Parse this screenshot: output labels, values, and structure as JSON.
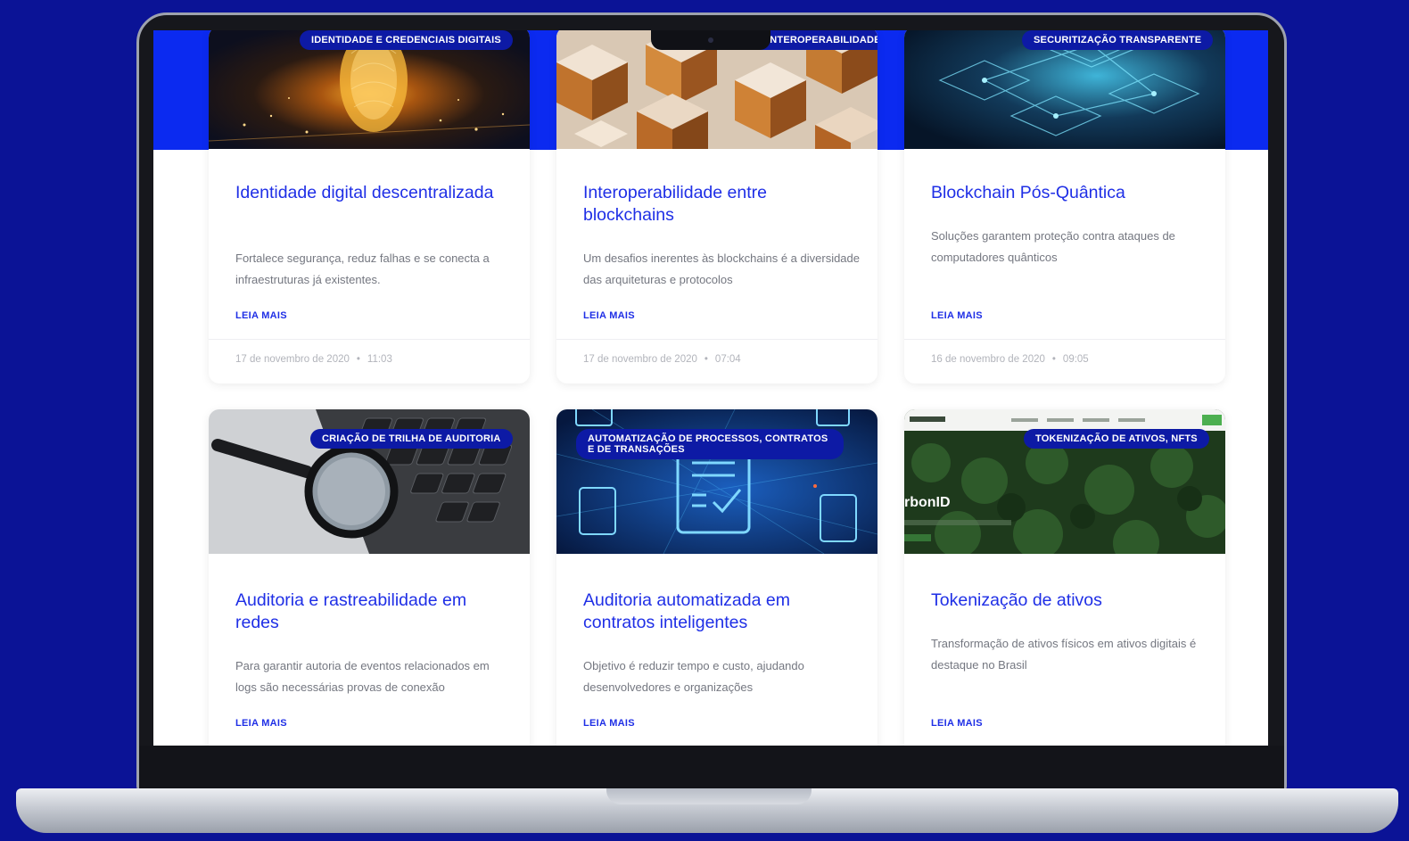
{
  "colors": {
    "background": "#0b1396",
    "accent": "#1f2fe6",
    "band": "#0b2af0",
    "tag": "#0d1aa5"
  },
  "read_more": "LEIA MAIS",
  "cards": [
    {
      "tag": "IDENTIDADE E CREDENCIAIS DIGITAIS",
      "title": "Identidade digital descentralizada",
      "description": "Fortalece segurança, reduz falhas e se conecta a infraestruturas já existentes.",
      "date": "17 de novembro de 2020",
      "time": "11:03",
      "image": "golden-fingerprint-city-image"
    },
    {
      "tag": "INTEROPERABILIDADE",
      "title": "Interoperabilidade entre blockchains",
      "description": "Um desafios inerentes às blockchains é a diversidade das arquiteturas e protocolos",
      "date": "17 de novembro de 2020",
      "time": "07:04",
      "image": "wooden-cubes-image"
    },
    {
      "tag": "SECURITIZAÇÃO TRANSPARENTE",
      "title": "Blockchain Pós-Quântica",
      "description": "Soluções garantem proteção contra ataques de computadores quânticos",
      "date": "16 de novembro de 2020",
      "time": "09:05",
      "image": "quantum-chip-network-image"
    },
    {
      "tag": "CRIAÇÃO DE TRILHA DE AUDITORIA",
      "title": "Auditoria e rastreabilidade em redes",
      "description": "Para garantir autoria de eventos relacionados em logs são necessárias provas de conexão",
      "image": "magnifier-keyboard-image"
    },
    {
      "tag": "AUTOMATIZAÇÃO DE PROCESSOS, CONTRATOS E DE TRANSAÇÕES",
      "title": "Auditoria automatizada em contratos inteligentes",
      "description": "Objetivo é reduzir tempo e custo, ajudando desenvolvedores e organizações",
      "image": "digital-documents-image"
    },
    {
      "tag": "TOKENIZAÇÃO DE ATIVOS, NFTS",
      "title": "Tokenização de ativos",
      "description": "Transformação de ativos físicos em ativos digitais é destaque no Brasil",
      "image": "forest-website-image",
      "image_text": "rbonID"
    }
  ]
}
